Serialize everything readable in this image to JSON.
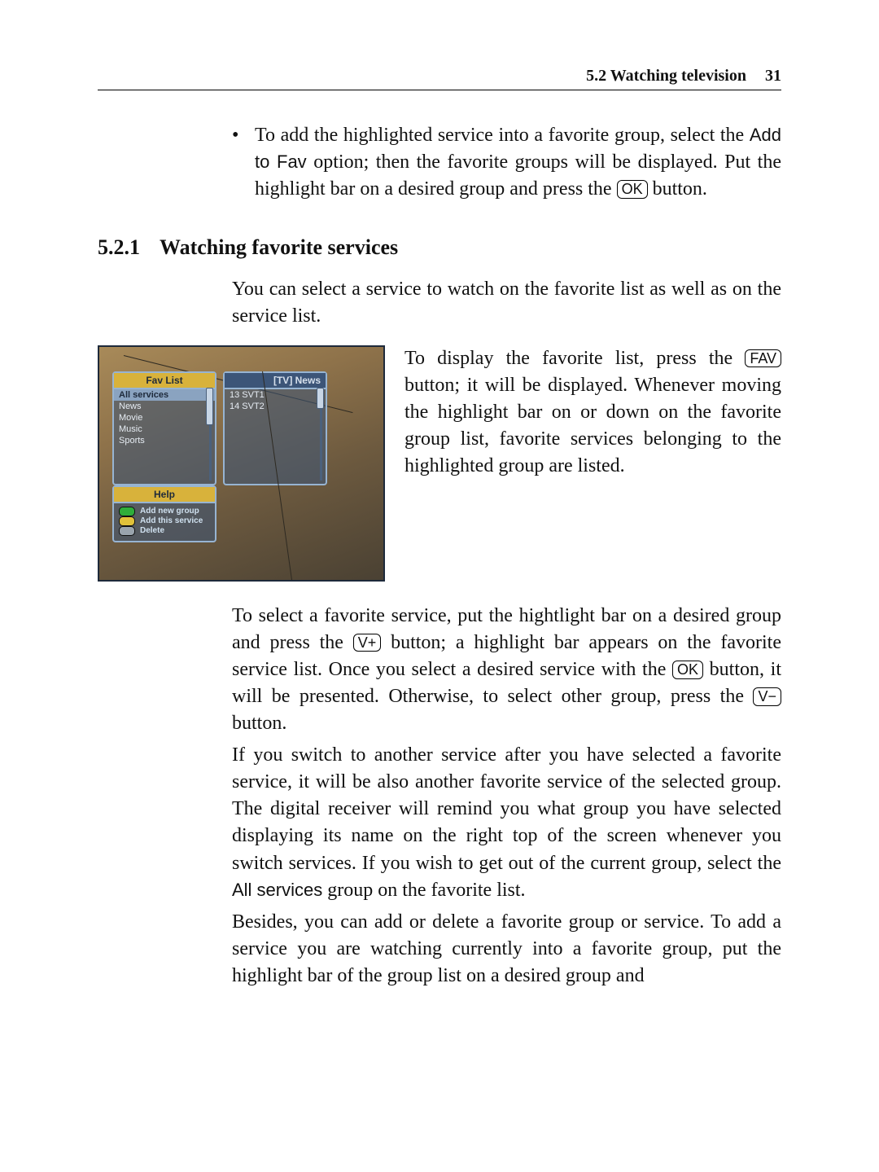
{
  "header": {
    "section_label": "5.2 Watching television",
    "page_number": "31"
  },
  "bullet": {
    "text_before_add": "To add the highlighted service into a favorite group, select the ",
    "add_to_fav": "Add to Fav",
    "text_after_add": " option; then the favorite groups will be displayed. Put the highlight bar on a desired group and press the ",
    "ok_key": "OK",
    "text_end": " button."
  },
  "subsection": {
    "number": "5.2.1",
    "title": "Watching favorite services"
  },
  "intro_para": "You can select a service to watch on the favorite list as well as on the service list.",
  "side_para": {
    "a": "To display the favorite list, press the ",
    "fav_key": "FAV",
    "b": " button; it will be displayed. Whenever moving the highlight bar on or down on the favorite group list, favorite services belonging to the highlighted group are listed."
  },
  "para2": {
    "a": "To select a favorite service, put the hightlight bar on a desired group and press the ",
    "vplus_key": "V+",
    "b": " button; a highlight bar appears on the favorite service list. Once you select a desired service with the ",
    "ok_key": "OK",
    "c": " button, it will be presented. Otherwise, to select other group, press the ",
    "vminus_key": "V−",
    "d": " button."
  },
  "para3": {
    "a": "If you switch to another service after you have selected a favorite service, it will be also another favorite service of the selected group. The digital receiver will remind you what group you have selected displaying its name on the right top of the screen whenever you switch services. If you wish to get out of the current group, select the ",
    "all_services": "All services",
    "b": " group on the favorite list."
  },
  "para4": "Besides, you can add or delete a favorite group or service.   To add a service you are watching currently into a favorite group, put the highlight bar of the group list on a desired group and",
  "screenshot": {
    "fav_panel": {
      "title": "Fav List",
      "items": [
        "All services",
        "News",
        "Movie",
        "Music",
        "Sports"
      ]
    },
    "right_panel": {
      "title": "[TV] News",
      "items": [
        "13  SVT1",
        "14  SVT2"
      ]
    },
    "help_panel": {
      "title": "Help",
      "rows": [
        {
          "color": "green",
          "label": "Add new group"
        },
        {
          "color": "yellow",
          "label": "Add this service"
        },
        {
          "color": "grey",
          "label": "Delete"
        }
      ]
    }
  }
}
